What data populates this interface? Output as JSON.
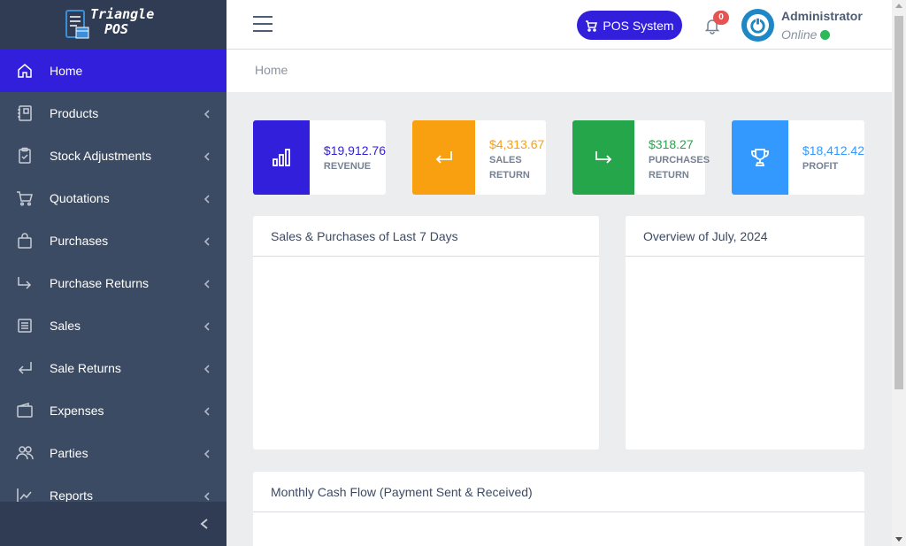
{
  "brand": {
    "line1": "Triangle",
    "line2": "POS"
  },
  "sidebar": {
    "items": [
      {
        "label": "Home",
        "icon": "home-icon",
        "active": true,
        "has_chevron": false
      },
      {
        "label": "Products",
        "icon": "notebook-icon",
        "has_chevron": true
      },
      {
        "label": "Stock Adjustments",
        "icon": "clipboard-icon",
        "has_chevron": true
      },
      {
        "label": "Quotations",
        "icon": "cart-icon",
        "has_chevron": true
      },
      {
        "label": "Purchases",
        "icon": "bag-icon",
        "has_chevron": true
      },
      {
        "label": "Purchase Returns",
        "icon": "arrow-right-return-icon",
        "has_chevron": true
      },
      {
        "label": "Sales",
        "icon": "list-icon",
        "has_chevron": true
      },
      {
        "label": "Sale Returns",
        "icon": "arrow-left-return-icon",
        "has_chevron": true
      },
      {
        "label": "Expenses",
        "icon": "wallet-icon",
        "has_chevron": true
      },
      {
        "label": "Parties",
        "icon": "people-icon",
        "has_chevron": true
      },
      {
        "label": "Reports",
        "icon": "chart-line-icon",
        "has_chevron": true
      }
    ]
  },
  "header": {
    "pos_button": "POS System",
    "notification_count": "0",
    "user_name": "Administrator",
    "user_status": "Online"
  },
  "breadcrumb": "Home",
  "stats": [
    {
      "value": "$19,912.76",
      "label": "REVENUE",
      "color": "#321fdb",
      "icon": "bar-chart-icon"
    },
    {
      "value": "$4,313.67",
      "label": "SALES RETURN",
      "color": "#f9b115",
      "icon": "arrow-left-return-icon"
    },
    {
      "value": "$318.27",
      "label": "PURCHASES RETURN",
      "color": "#2eb85c",
      "icon": "arrow-right-return-icon"
    },
    {
      "value": "$18,412.42",
      "label": "PROFIT",
      "color": "#3399ff",
      "icon": "trophy-icon"
    }
  ],
  "panels": {
    "sales_purchases": "Sales & Purchases of Last 7 Days",
    "overview": "Overview of July, 2024",
    "cash_flow": "Monthly Cash Flow (Payment Sent & Received)"
  }
}
